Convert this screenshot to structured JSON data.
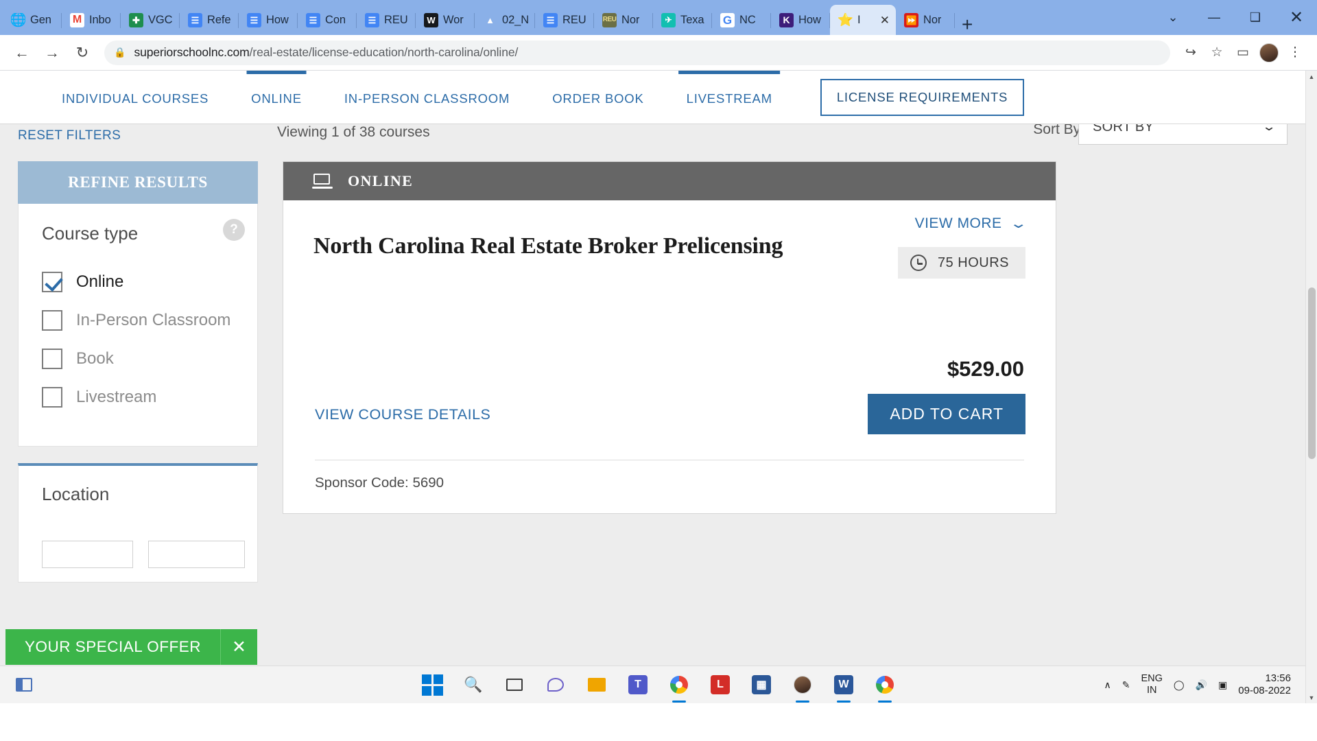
{
  "browser": {
    "tabs": [
      {
        "label": "Gen",
        "icon": "globe-icon",
        "favicon": "fav-globe",
        "glyph": "🌐",
        "active": false
      },
      {
        "label": "Inbo",
        "icon": "gmail-icon",
        "favicon": "fav-gmail",
        "glyph": "M",
        "active": false
      },
      {
        "label": "VGC",
        "icon": "vgc-icon",
        "favicon": "fav-vgc",
        "glyph": "✚",
        "active": false
      },
      {
        "label": "Refe",
        "icon": "google-docs-icon",
        "favicon": "fav-docs",
        "glyph": "☰",
        "active": false
      },
      {
        "label": "How",
        "icon": "google-docs-icon",
        "favicon": "fav-docs",
        "glyph": "☰",
        "active": false
      },
      {
        "label": "Con",
        "icon": "google-docs-icon",
        "favicon": "fav-docs",
        "glyph": "☰",
        "active": false
      },
      {
        "label": "REU",
        "icon": "google-docs-icon",
        "favicon": "fav-docs",
        "glyph": "☰",
        "active": false
      },
      {
        "label": "Wor",
        "icon": "word-icon",
        "favicon": "fav-word",
        "glyph": "W",
        "active": false
      },
      {
        "label": "02_N",
        "icon": "google-drive-icon",
        "favicon": "fav-drive",
        "glyph": "▲",
        "active": false
      },
      {
        "label": "REU",
        "icon": "google-docs-icon",
        "favicon": "fav-docs",
        "glyph": "☰",
        "active": false
      },
      {
        "label": "Nor",
        "icon": "reu-icon",
        "favicon": "fav-reu",
        "glyph": "REU",
        "active": false
      },
      {
        "label": "Texa",
        "icon": "texas-icon",
        "favicon": "fav-texa",
        "glyph": "✈",
        "active": false
      },
      {
        "label": "NC",
        "icon": "google-search-icon",
        "favicon": "fav-google",
        "glyph": "G",
        "active": false
      },
      {
        "label": "How",
        "icon": "kaplan-icon",
        "favicon": "fav-k",
        "glyph": "K",
        "active": false
      },
      {
        "label": "I",
        "icon": "star-icon",
        "favicon": "fav-star",
        "glyph": "⭐",
        "active": true
      },
      {
        "label": "Nor",
        "icon": "fast-forward-icon",
        "favicon": "fav-red",
        "glyph": "⏩",
        "active": false
      }
    ],
    "tab_close_glyph": "✕",
    "new_tab_glyph": "+",
    "window_controls": {
      "minimize": "—",
      "maximize": "❑",
      "close": "✕",
      "tab_search": "⌄"
    },
    "back_glyph": "←",
    "forward_glyph": "→",
    "reload_glyph": "↻",
    "lock_glyph": "🔒",
    "url_domain": "superiorschoolnc.com",
    "url_path": "/real-estate/license-education/north-carolina/online/",
    "share_glyph": "↪",
    "bookmark_glyph": "☆",
    "sidepanel_glyph": "▭",
    "menu_glyph": "⋮"
  },
  "sitenav": {
    "items": [
      {
        "label": "INDIVIDUAL COURSES",
        "marked": false,
        "boxed": false
      },
      {
        "label": "ONLINE",
        "marked": true,
        "boxed": false
      },
      {
        "label": "IN-PERSON CLASSROOM",
        "marked": false,
        "boxed": false
      },
      {
        "label": "ORDER BOOK",
        "marked": false,
        "boxed": false
      },
      {
        "label": "LIVESTREAM",
        "marked": true,
        "boxed": false
      },
      {
        "label": "LICENSE REQUIREMENTS",
        "marked": false,
        "boxed": true
      }
    ]
  },
  "subbar": {
    "reset_filters": "RESET FILTERS",
    "viewing": "Viewing 1 of 38 courses",
    "sort_by_label": "Sort By:",
    "sort_value": "SORT BY",
    "sort_chevron": "⌄"
  },
  "sidebar": {
    "header": "REFINE RESULTS",
    "course_type": {
      "title": "Course type",
      "help_glyph": "?",
      "options": [
        {
          "label": "Online",
          "checked": true
        },
        {
          "label": "In-Person Classroom",
          "checked": false
        },
        {
          "label": "Book",
          "checked": false
        },
        {
          "label": "Livestream",
          "checked": false
        }
      ]
    },
    "location": {
      "title": "Location"
    }
  },
  "offer": {
    "text": "YOUR SPECIAL OFFER",
    "close_glyph": "✕"
  },
  "card": {
    "type_label": "ONLINE",
    "type_icon": "laptop-icon",
    "title": "North Carolina Real Estate Broker Prelicensing",
    "view_more": "VIEW MORE",
    "view_more_chevron": "⌄",
    "hours": "75 HOURS",
    "hours_icon": "clock-icon",
    "price": "$529.00",
    "add_to_cart": "ADD TO CART",
    "details_link": "VIEW COURSE DETAILS",
    "sponsor": "Sponsor Code: 5690"
  },
  "taskbar": {
    "start_glyph": "⊞",
    "search_glyph": "🔍",
    "taskview_glyph": "▭",
    "chat_glyph": "💬",
    "explorer_glyph": "📁",
    "teams_glyph": "👥",
    "chrome_glyph": "●",
    "lastpass_glyph": "L",
    "store_glyph": "⊞",
    "word_glyph": "W",
    "tray_up_glyph": "∧",
    "tray_pen_glyph": "✎",
    "wifi_glyph": "◠",
    "volume_glyph": "🔊",
    "battery_glyph": "▭",
    "language_line1": "ENG",
    "language_line2": "IN",
    "time": "13:56",
    "date": "09-08-2022",
    "show_desktop": "|"
  }
}
